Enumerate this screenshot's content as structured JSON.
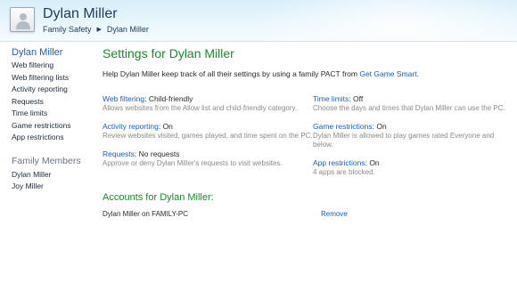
{
  "header": {
    "title": "Dylan Miller",
    "breadcrumb": [
      "Family Safety",
      "Dylan Miller"
    ]
  },
  "sidebar": {
    "active_user": "Dylan Miller",
    "items": [
      {
        "label": "Web filtering"
      },
      {
        "label": "Web filtering lists"
      },
      {
        "label": "Activity reporting"
      },
      {
        "label": "Requests"
      },
      {
        "label": "Time limits"
      },
      {
        "label": "Game restrictions"
      },
      {
        "label": "App restrictions"
      }
    ],
    "family_title": "Family Members",
    "members": [
      {
        "label": "Dylan Miller"
      },
      {
        "label": "Joy Miller"
      }
    ]
  },
  "main": {
    "title": "Settings for Dylan Miller",
    "intro_text": "Help Dylan Miller keep track of all their settings by using a family PACT from ",
    "intro_link": "Get Game Smart",
    "intro_end": ".",
    "left_settings": [
      {
        "link": "Web filtering",
        "value": ": Child-friendly",
        "desc": "Allows websites from the Allow list and child-friendly category."
      },
      {
        "link": "Activity reporting",
        "value": ": On",
        "desc": "Review websites visited, games played, and time spent on the PC."
      },
      {
        "link": "Requests",
        "value": ": No requests",
        "desc": "Approve or deny Dylan Miller's requests to visit websites."
      }
    ],
    "right_settings": [
      {
        "link": "Time limits",
        "value": ": Off",
        "desc": "Choose the days and times that Dylan Miller can use the PC."
      },
      {
        "link": "Game restrictions",
        "value": ": On",
        "desc": "Dylan Miller is allowed to play games rated Everyone and below."
      },
      {
        "link": "App restrictions",
        "value": ": On",
        "desc": "4 apps are blocked."
      }
    ],
    "accounts_title": "Accounts for Dylan Miller:",
    "account": {
      "name": "Dylan Miller on FAMILY-PC",
      "action": "Remove"
    }
  },
  "colors": {
    "accent_green": "#1b8a2e",
    "link_blue": "#1a5fb4"
  }
}
